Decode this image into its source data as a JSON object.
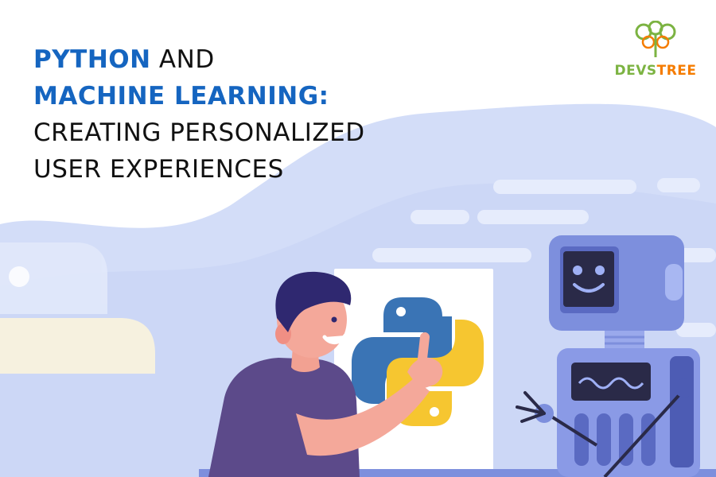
{
  "headline": {
    "line1_bold": "PYTHON",
    "line1_regular": " AND",
    "line2_bold": "MACHINE LEARNING:",
    "line3": "CREATING PERSONALIZED",
    "line4": "USER EXPERIENCES"
  },
  "brand": {
    "name_part1": "DEVS",
    "name_part2": "TREE"
  },
  "colors": {
    "headline_accent": "#1565c0",
    "headline_text": "#111111",
    "background_wave": "#cfd9f7",
    "robot": "#7d8fdd",
    "robot_screen": "#2a2a48",
    "python_blue": "#3a74b5",
    "python_yellow": "#f6c630",
    "shirt": "#5c4a8a",
    "skin": "#f4a89a",
    "hair": "#2f2870"
  },
  "icons": [
    "python-logo-icon",
    "devstree-tree-logo-icon",
    "robot-illustration",
    "person-illustration"
  ]
}
